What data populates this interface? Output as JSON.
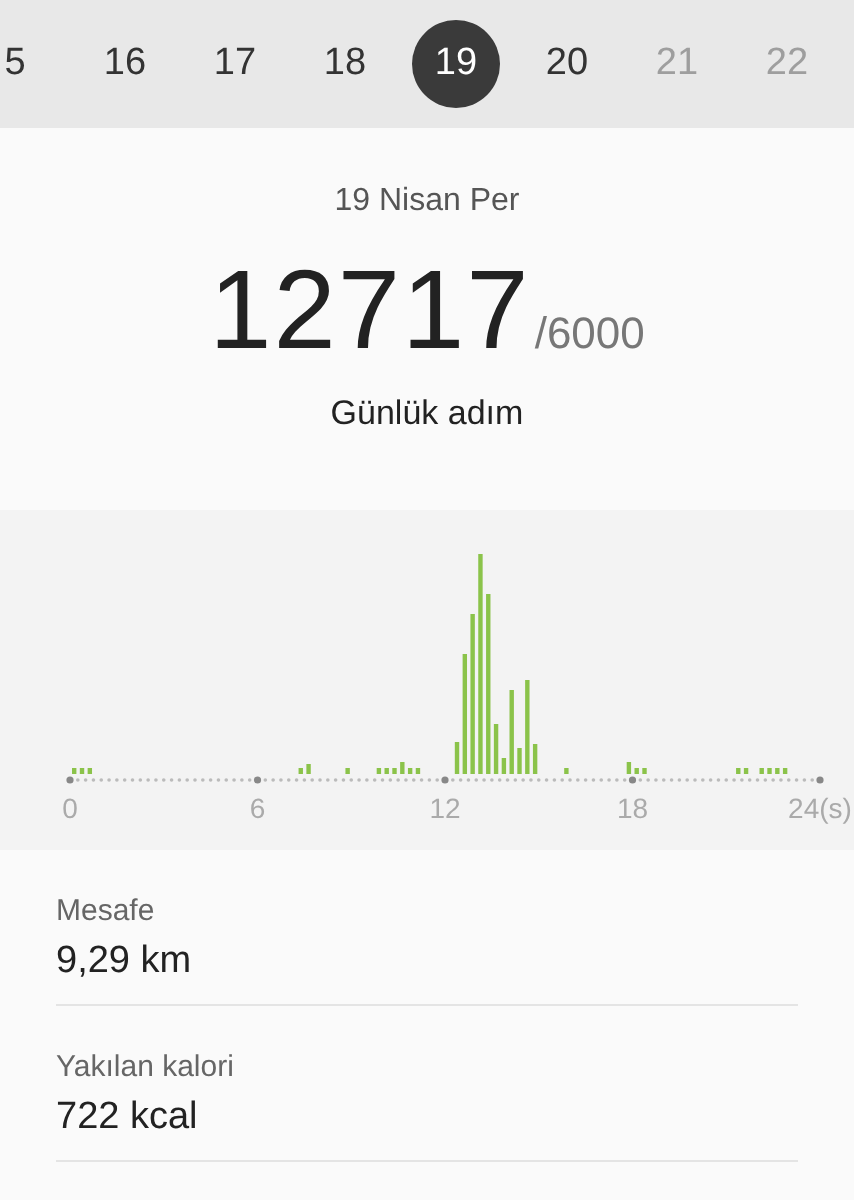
{
  "days": [
    {
      "label": "5",
      "selected": false,
      "disabled": false
    },
    {
      "label": "16",
      "selected": false,
      "disabled": false
    },
    {
      "label": "17",
      "selected": false,
      "disabled": false
    },
    {
      "label": "18",
      "selected": false,
      "disabled": false
    },
    {
      "label": "19",
      "selected": true,
      "disabled": false
    },
    {
      "label": "20",
      "selected": false,
      "disabled": false
    },
    {
      "label": "21",
      "selected": false,
      "disabled": true
    },
    {
      "label": "22",
      "selected": false,
      "disabled": true
    }
  ],
  "summary": {
    "date": "19 Nisan Per",
    "steps": "12717",
    "goal": "/6000",
    "caption": "Günlük adım"
  },
  "chart": {
    "x_labels": [
      "0",
      "6",
      "12",
      "18",
      "24(s)"
    ]
  },
  "stats": [
    {
      "label": "Mesafe",
      "value": "9,29 km"
    },
    {
      "label": "Yakılan kalori",
      "value": "722 kcal"
    }
  ]
}
